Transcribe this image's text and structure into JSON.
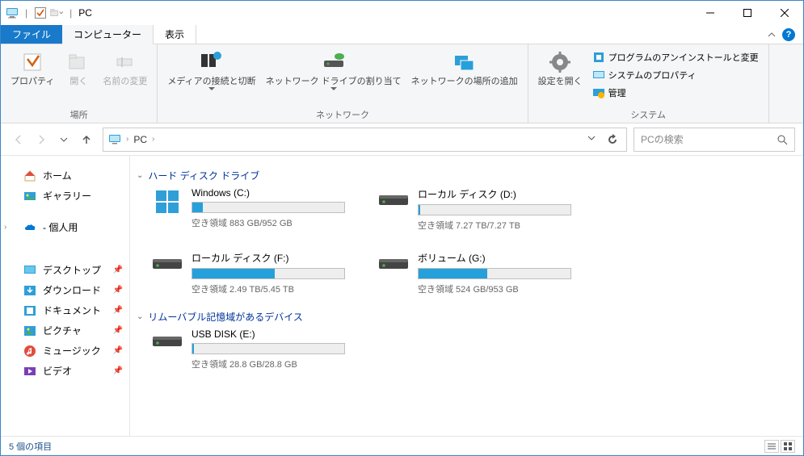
{
  "window": {
    "title": "PC"
  },
  "tabs": {
    "file": "ファイル",
    "computer": "コンピューター",
    "view": "表示"
  },
  "ribbon": {
    "location": {
      "properties": "プロパティ",
      "open": "開く",
      "rename": "名前の変更",
      "group_label": "場所"
    },
    "network": {
      "media": "メディアの接続と切断",
      "map_drive": "ネットワーク ドライブの割り当て",
      "add_location": "ネットワークの場所の追加",
      "group_label": "ネットワーク"
    },
    "system": {
      "settings": "設定を開く",
      "uninstall": "プログラムのアンインストールと変更",
      "sys_props": "システムのプロパティ",
      "manage": "管理",
      "group_label": "システム"
    }
  },
  "nav": {
    "location": "PC",
    "search_placeholder": "PCの検索"
  },
  "sidebar": {
    "home": "ホーム",
    "gallery": "ギャラリー",
    "personal": "- 個人用",
    "desktop": "デスクトップ",
    "downloads": "ダウンロード",
    "documents": "ドキュメント",
    "pictures": "ピクチャ",
    "music": "ミュージック",
    "videos": "ビデオ"
  },
  "groups": {
    "hdd": "ハード ディスク ドライブ",
    "removable": "リムーバブル記憶域があるデバイス"
  },
  "drives": [
    {
      "name": "Windows (C:)",
      "free_text": "空き領域 883 GB/952 GB",
      "fill_pct": 7,
      "icon": "win"
    },
    {
      "name": "ローカル ディスク (D:)",
      "free_text": "空き領域 7.27 TB/7.27 TB",
      "fill_pct": 1,
      "icon": "hdd"
    },
    {
      "name": "ローカル ディスク (F:)",
      "free_text": "空き領域 2.49 TB/5.45 TB",
      "fill_pct": 54,
      "icon": "hdd"
    },
    {
      "name": "ボリューム (G:)",
      "free_text": "空き領域 524 GB/953 GB",
      "fill_pct": 45,
      "icon": "hdd"
    }
  ],
  "removable": [
    {
      "name": "USB DISK (E:)",
      "free_text": "空き領域 28.8 GB/28.8 GB",
      "fill_pct": 1,
      "icon": "hdd"
    }
  ],
  "status": {
    "count": "5 個の項目"
  }
}
